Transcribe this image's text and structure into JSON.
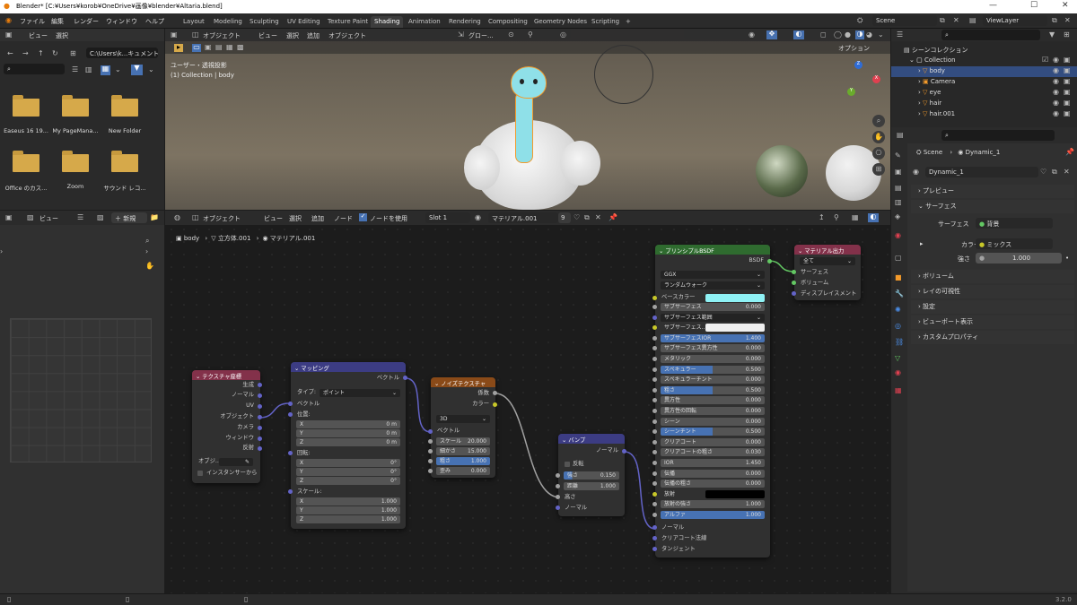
{
  "window": {
    "title": "Blender* [C:¥Users¥korob¥OneDrive¥画像¥blender¥Altaria.blend]",
    "min": "—",
    "max": "☐",
    "close": "✕"
  },
  "menu": [
    "ファイル",
    "編集",
    "レンダー",
    "ウィンドウ",
    "ヘルプ"
  ],
  "workspaces": [
    "Layout",
    "Modeling",
    "Sculpting",
    "UV Editing",
    "Texture Paint",
    "Shading",
    "Animation",
    "Rendering",
    "Compositing",
    "Geometry Nodes",
    "Scripting",
    "+"
  ],
  "active_workspace": "Shading",
  "scene": "Scene",
  "view_layer": "ViewLayer",
  "filebrowser": {
    "menu": [
      "ビュー",
      "選択"
    ],
    "path": "C:\\Users\\k...キュメント\\",
    "folders": [
      "Easeus 16 19...",
      "My PageMana...",
      "New Folder",
      "Office のカス...",
      "Zoom",
      "サウンド レコ..."
    ]
  },
  "viewport": {
    "mode": "オブジェクト",
    "menu": [
      "ビュー",
      "選択",
      "追加",
      "オブジェクト"
    ],
    "transform": "グロー...",
    "overlay_label": "ユーザー・透視投影",
    "collection_label": "(1) Collection | body",
    "options": "オプション"
  },
  "image_editor": {
    "menu": "ビュー",
    "new": "新規"
  },
  "node_editor": {
    "mode": "オブジェクト",
    "menu": [
      "ビュー",
      "選択",
      "追加",
      "ノード"
    ],
    "use_nodes": "ノードを使用",
    "slot": "Slot 1",
    "material": "マテリアル.001",
    "users": "9",
    "breadcrumb": [
      "body",
      "立方体.001",
      "マテリアル.001"
    ]
  },
  "nodes": {
    "texcoord": {
      "title": "テクスチャ座標",
      "outputs": [
        "生成",
        "ノーマル",
        "UV",
        "オブジェクト",
        "カメラ",
        "ウィンドウ",
        "反射"
      ],
      "object_label": "オブジ...",
      "instancer": "インスタンサーから"
    },
    "mapping": {
      "title": "マッピング",
      "out": "ベクトル",
      "type_label": "タイプ:",
      "type": "ポイント",
      "vector": "ベクトル",
      "location": "位置:",
      "rotation": "回転:",
      "scale": "スケール:",
      "loc": [
        [
          "X",
          "0 m"
        ],
        [
          "Y",
          "0 m"
        ],
        [
          "Z",
          "0 m"
        ]
      ],
      "rot": [
        [
          "X",
          "0°"
        ],
        [
          "Y",
          "0°"
        ],
        [
          "Z",
          "0°"
        ]
      ],
      "scl": [
        [
          "X",
          "1.000"
        ],
        [
          "Y",
          "1.000"
        ],
        [
          "Z",
          "1.000"
        ]
      ]
    },
    "noise": {
      "title": "ノイズテクスチャ",
      "out1": "係数",
      "out2": "カラー",
      "dim": "3D",
      "vector": "ベクトル",
      "fields": [
        [
          "スケール",
          "20.000"
        ],
        [
          "細かさ",
          "15.000"
        ],
        [
          "粗さ",
          "1.000"
        ],
        [
          "歪み",
          "0.000"
        ]
      ]
    },
    "bump": {
      "title": "バンプ",
      "out": "ノーマル",
      "invert": "反転",
      "strength": [
        "強さ",
        "0.150"
      ],
      "distance": [
        "距離",
        "1.000"
      ],
      "height": "高さ",
      "normal": "ノーマル"
    },
    "bsdf": {
      "title": "プリンシプルBSDF",
      "out": "BSDF",
      "dist": "GGX",
      "sss_method": "ランダムウォーク",
      "base_color": "ベースカラー",
      "fields": [
        [
          "サブサーフェス",
          "0.000"
        ],
        [
          "サブサーフェス範囲",
          ""
        ],
        [
          "サブサーフェス...",
          ""
        ],
        [
          "サブサーフェスIOR",
          "1.400"
        ],
        [
          "サブサーフェス異方性",
          "0.000"
        ],
        [
          "メタリック",
          "0.000"
        ],
        [
          "スペキュラー",
          "0.500"
        ],
        [
          "スペキュラーチント",
          "0.000"
        ],
        [
          "粗さ",
          "0.500"
        ],
        [
          "異方性",
          "0.000"
        ],
        [
          "異方性の回転",
          "0.000"
        ],
        [
          "シーン",
          "0.000"
        ],
        [
          "シーンチント",
          "0.500"
        ],
        [
          "クリアコート",
          "0.000"
        ],
        [
          "クリアコートの粗さ",
          "0.030"
        ],
        [
          "IOR",
          "1.450"
        ],
        [
          "伝播",
          "0.000"
        ],
        [
          "伝播の粗さ",
          "0.000"
        ],
        [
          "放射",
          ""
        ],
        [
          "放射の強さ",
          "1.000"
        ],
        [
          "アルファ",
          "1.000"
        ]
      ],
      "inputs": [
        "ノーマル",
        "クリアコート法線",
        "タンジェント"
      ]
    },
    "output": {
      "title": "マテリアル出力",
      "target": "全て",
      "inputs": [
        "サーフェス",
        "ボリューム",
        "ディスプレイスメント"
      ]
    }
  },
  "outliner": {
    "scene_collection": "シーンコレクション",
    "collection": "Collection",
    "items": [
      "body",
      "Camera",
      "eye",
      "hair",
      "hair.001"
    ]
  },
  "properties": {
    "scene": "Scene",
    "object": "Dynamic_1",
    "material": "Dynamic_1",
    "sections": [
      "プレビュー",
      "サーフェス",
      "ボリューム",
      "レイの可視性",
      "設定",
      "ビューポート表示",
      "カスタムプロパティ"
    ],
    "surface_label": "サーフェス",
    "surface_value": "背景",
    "color_label": "カラー",
    "color_value": "ミックス",
    "strength_label": "強さ",
    "strength_value": "1.000"
  },
  "status": {
    "version": "3.2.0"
  },
  "colors": {
    "accent": "#4772b3",
    "base_color": "#8ff2f5",
    "selected": "#334d80"
  }
}
